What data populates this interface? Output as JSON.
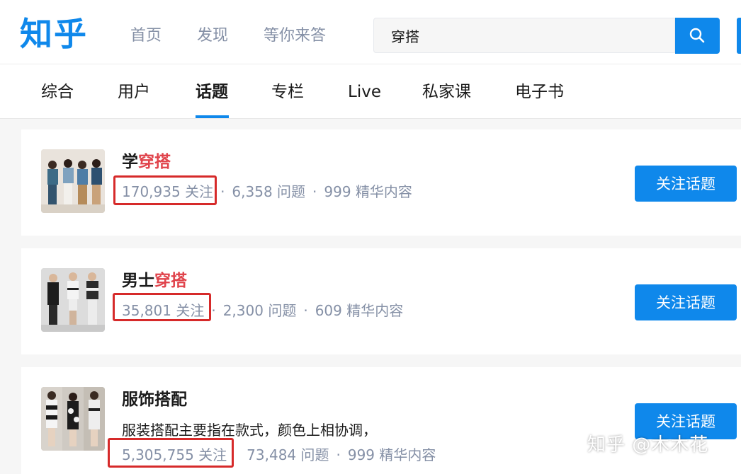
{
  "header": {
    "logo": "知乎",
    "nav": [
      "首页",
      "发现",
      "等你来答"
    ],
    "search_value": "穿搭",
    "search_icon": "search-icon"
  },
  "tabs": [
    "综合",
    "用户",
    "话题",
    "专栏",
    "Live",
    "私家课",
    "电子书"
  ],
  "active_tab": "话题",
  "results": [
    {
      "title_prefix": "学",
      "title_highlight": "穿搭",
      "followers": "170,935 关注",
      "questions": "6,358 问题",
      "featured": "999 精华内容",
      "button": "关注话题"
    },
    {
      "title_prefix": "男士",
      "title_highlight": "穿搭",
      "followers": "35,801 关注",
      "questions": "2,300 问题",
      "featured": "609 精华内容",
      "button": "关注话题"
    },
    {
      "title_prefix": "服饰搭配",
      "title_highlight": "",
      "description": "服装搭配主要指在款式，颜色上相协调，",
      "followers": "5,305,755 关注",
      "questions": "73,484 问题",
      "featured": "999 精华内容",
      "button": "关注话题"
    }
  ],
  "separator": "·",
  "watermark": "知乎 @木木花",
  "colors": {
    "brand_blue": "#0f88eb",
    "highlight_red": "#e0434b",
    "annotation_red": "#d62a2a",
    "meta_gray": "#8590a6"
  }
}
